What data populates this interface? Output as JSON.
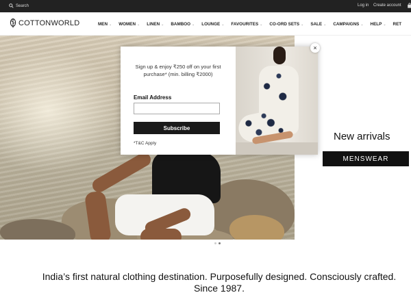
{
  "topbar": {
    "search_placeholder": "Search",
    "login_label": "Log in",
    "create_account_label": "Create account",
    "icons": {
      "search": "search-icon",
      "bag": "bag-icon"
    }
  },
  "header": {
    "logo_text": "COTTONWORLD",
    "nav": [
      {
        "label": "MEN",
        "has_dropdown": true
      },
      {
        "label": "WOMEN",
        "has_dropdown": true
      },
      {
        "label": "LINEN",
        "has_dropdown": true
      },
      {
        "label": "BAMBOO",
        "has_dropdown": true
      },
      {
        "label": "LOUNGE",
        "has_dropdown": true
      },
      {
        "label": "FAVOURITES",
        "has_dropdown": true
      },
      {
        "label": "CO-ORD SETS",
        "has_dropdown": true
      },
      {
        "label": "SALE",
        "has_dropdown": true
      },
      {
        "label": "CAMPAIGNS",
        "has_dropdown": true
      },
      {
        "label": "HELP",
        "has_dropdown": true
      },
      {
        "label": "RET",
        "has_dropdown": false
      }
    ]
  },
  "hero": {
    "slides_total": 2,
    "active_slide": 2
  },
  "promo_side": {
    "heading": "New arrivals",
    "button_label": "MENSWEAR"
  },
  "tagline": {
    "line1": "India’s first natural clothing destination. Purposefully designed. Consciously crafted.",
    "line2": "Since 1987."
  },
  "popup": {
    "promo_text": "Sign up & enjoy ₹250 off on your first purchase* (min. billing ₹2000)",
    "email_label": "Email Address",
    "email_placeholder": "",
    "subscribe_label": "Subscribe",
    "terms": "*T&C Apply",
    "close_label": "×"
  },
  "colors": {
    "topbar_bg": "#222222",
    "button_bg": "#111111",
    "button_text": "#ffffff"
  }
}
